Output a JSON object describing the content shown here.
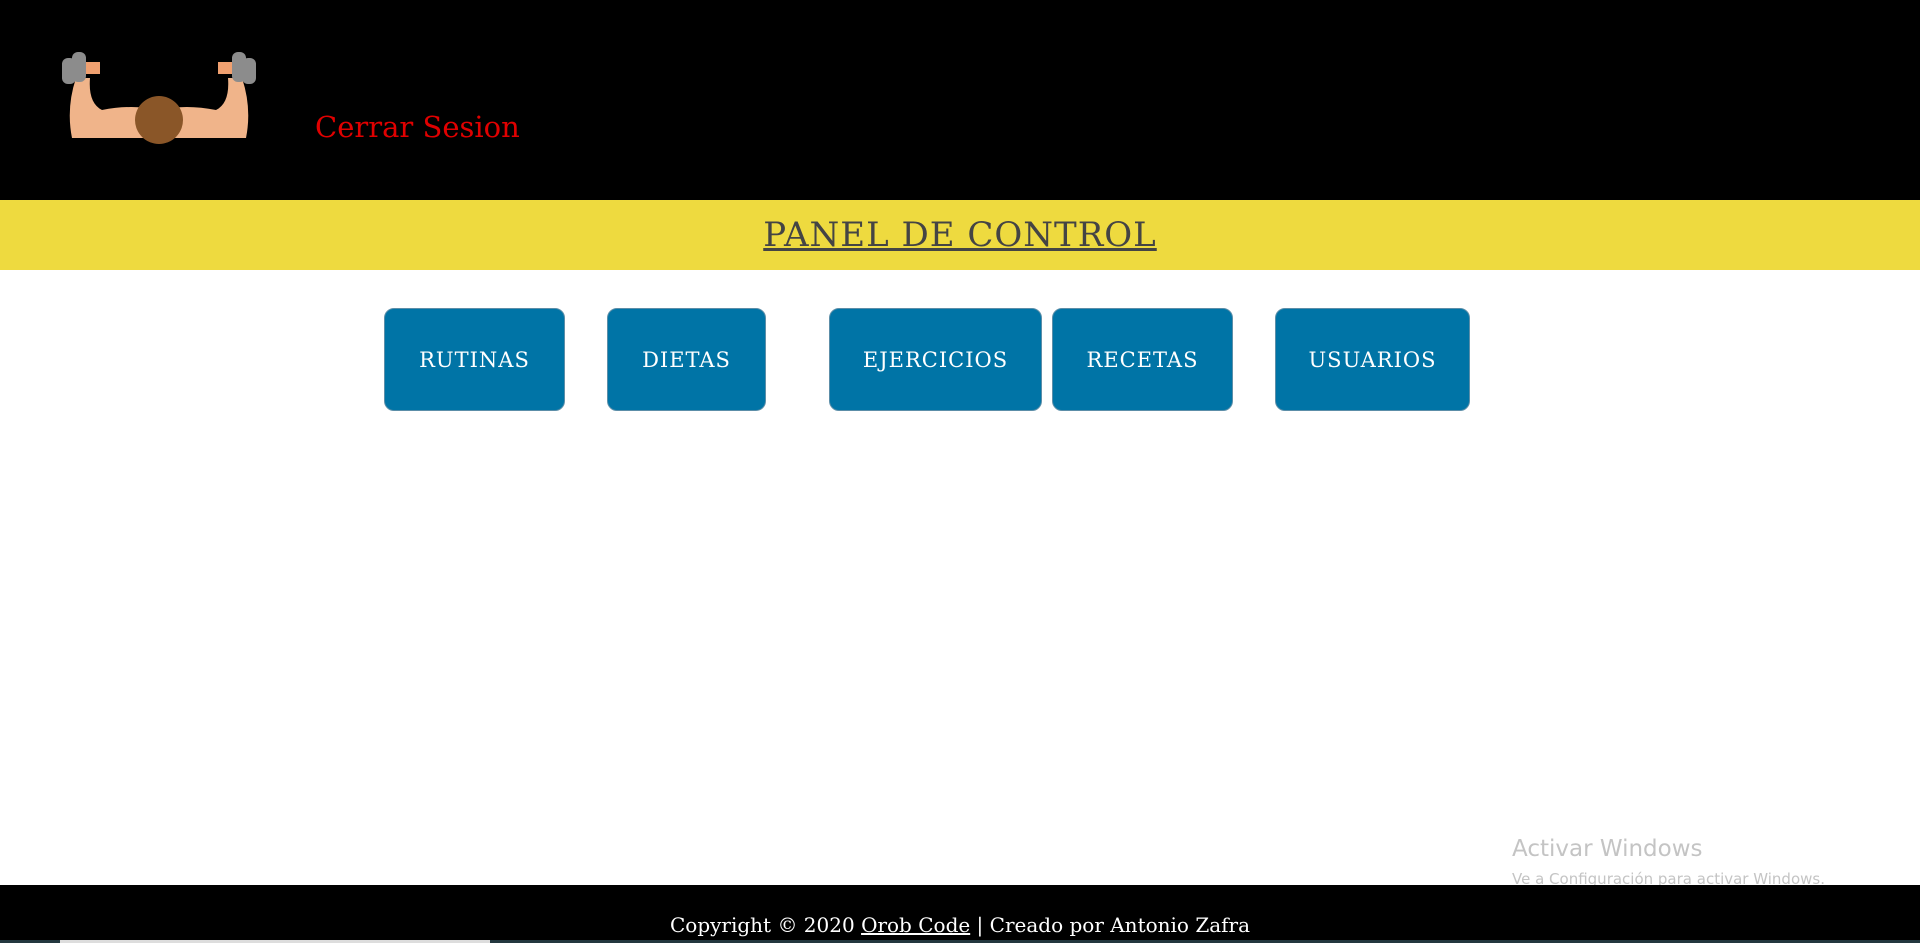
{
  "header": {
    "logo": "muscle-arms-dumbbells-logo",
    "logout_label": "Cerrar Sesion",
    "logout_color": "#e00000"
  },
  "banner": {
    "title": "PANEL DE CONTROL",
    "color": "#eeda3f"
  },
  "menu": {
    "buttons": [
      {
        "label": "RUTINAS"
      },
      {
        "label": "DIETAS"
      },
      {
        "label": "EJERCICIOS"
      },
      {
        "label": "RECETAS"
      },
      {
        "label": "USUARIOS"
      }
    ],
    "button_color": "#0074a6"
  },
  "watermark": {
    "line1": "Activar Windows",
    "line2": "Ve a Configuración para activar Windows."
  },
  "footer": {
    "prefix": "Copyright © 2020 ",
    "link": "Orob Code",
    "suffix": " | Creado por Antonio Zafra"
  }
}
